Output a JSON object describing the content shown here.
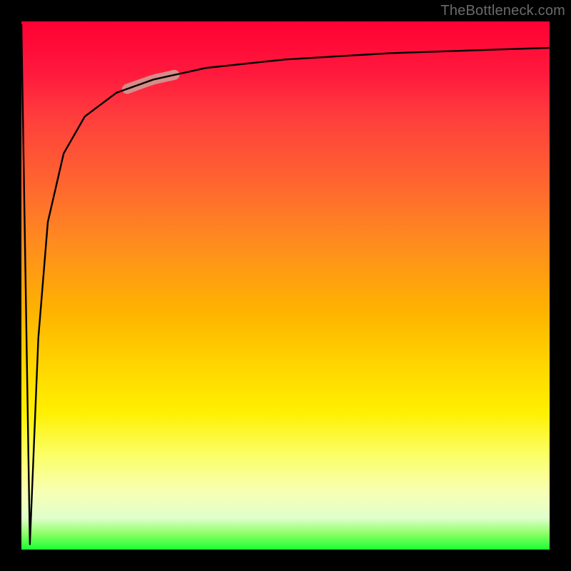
{
  "watermark": "TheBottleneck.com",
  "chart_data": {
    "type": "line",
    "title": "",
    "xlabel": "",
    "ylabel": "",
    "xlim": [
      0,
      100
    ],
    "ylim": [
      0,
      100
    ],
    "grid": false,
    "legend": false,
    "background_gradient": {
      "direction": "vertical",
      "stops": [
        {
          "pos": 0,
          "color": "#ff0033"
        },
        {
          "pos": 42,
          "color": "#ff8c1f"
        },
        {
          "pos": 74,
          "color": "#fff000"
        },
        {
          "pos": 97,
          "color": "#8cff66"
        },
        {
          "pos": 100,
          "color": "#1aff33"
        }
      ]
    },
    "series": [
      {
        "name": "left-spike-down",
        "stroke": "#000000",
        "x": [
          0.0,
          1.6,
          3.2
        ],
        "y": [
          99.5,
          1.0,
          40.0
        ]
      },
      {
        "name": "bottleneck-curve",
        "stroke": "#000000",
        "x": [
          3.2,
          5,
          8,
          12,
          18,
          25,
          35,
          50,
          70,
          100
        ],
        "y": [
          40.0,
          62,
          75,
          82,
          86.5,
          89,
          91.2,
          92.8,
          94.0,
          95.0
        ]
      }
    ],
    "highlight_segment": {
      "on_series": "bottleneck-curve",
      "x_range": [
        20,
        29
      ],
      "stroke": "#d68c88",
      "stroke_width": 14,
      "linecap": "round"
    }
  }
}
